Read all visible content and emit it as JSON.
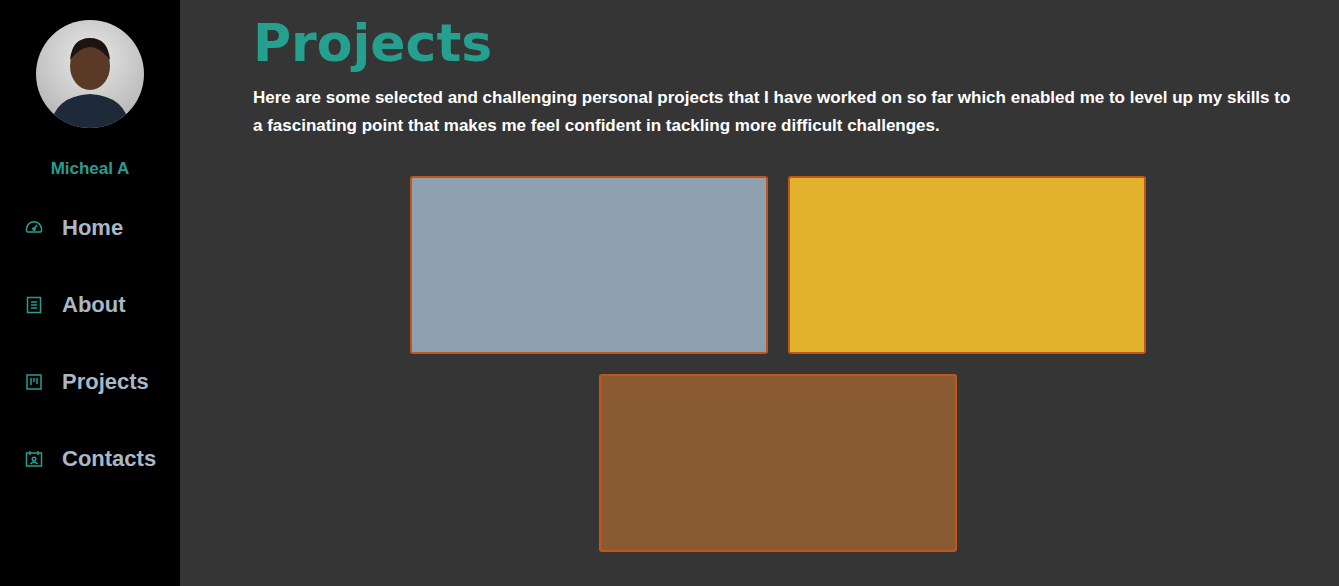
{
  "sidebar": {
    "name": "Micheal A",
    "items": [
      {
        "label": "Home"
      },
      {
        "label": "About"
      },
      {
        "label": "Projects"
      },
      {
        "label": "Contacts"
      }
    ]
  },
  "page": {
    "title": "Projects",
    "intro": "Here are some selected and challenging personal projects that I have worked on so far which enabled me to level up my skills to a fascinating point that makes me feel confident in tackling more difficult challenges."
  },
  "projects": [
    {
      "color": "#8fa1ae"
    },
    {
      "color": "#e3b22c"
    },
    {
      "color": "#8a5a33"
    }
  ]
}
